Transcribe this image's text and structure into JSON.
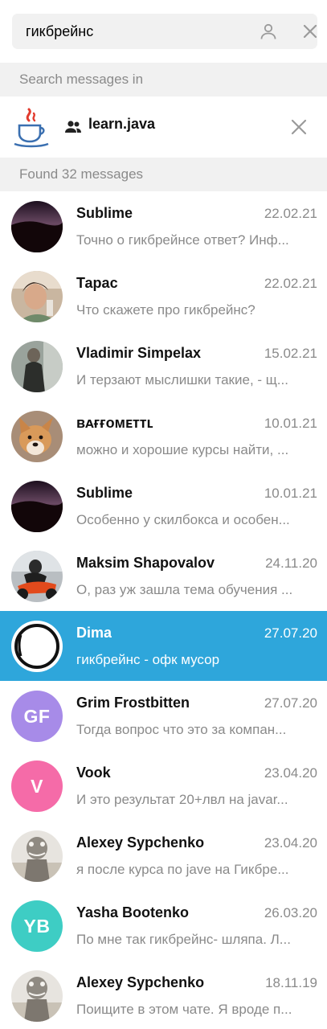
{
  "search": {
    "query": "гикбрейнс"
  },
  "scope": {
    "header": "Search messages in",
    "chat_name": "learn.java"
  },
  "results": {
    "header": "Found 32 messages",
    "items": [
      {
        "name": "Sublime",
        "date": "22.02.21",
        "text": "Точно о гикбрейнсе ответ? Инф...",
        "avatar": "photo-dark-sky"
      },
      {
        "name": "Тарас",
        "date": "22.02.21",
        "text": "Что скажете про гикбрейнс?",
        "avatar": "photo-person"
      },
      {
        "name": "Vladimir Simpelax",
        "date": "15.02.21",
        "text": "И терзают мыслишки такие, - щ...",
        "avatar": "photo-person-dark"
      },
      {
        "name": "ʙᴀғғᴏᴍᴇᴛᴛʟ",
        "date": "10.01.21",
        "text": "можно и хорошие курсы найти, ...",
        "avatar": "photo-dog"
      },
      {
        "name": "Sublime",
        "date": "10.01.21",
        "text": "Особенно у скилбокса и особен...",
        "avatar": "photo-dark-sky"
      },
      {
        "name": "Maksim Shapovalov",
        "date": "24.11.20",
        "text": "О, раз уж зашла тема обучения ...",
        "avatar": "photo-motorcycle"
      },
      {
        "name": "Dima",
        "date": "27.07.20",
        "text": "гикбрейнс - офк мусор",
        "avatar": "photo-ring",
        "selected": true
      },
      {
        "name": "Grim Frostbitten",
        "date": "27.07.20",
        "text": "Тогда вопрос что это за компан...",
        "initials": "GF",
        "color": "#a78be8"
      },
      {
        "name": "Vook",
        "date": "23.04.20",
        "text": "И это результат 20+лвл на javar...",
        "initials": "V",
        "color": "#f56ba8"
      },
      {
        "name": "Alexey Sypchenko",
        "date": "23.04.20",
        "text": "я после курса по jave на Гикбре...",
        "avatar": "photo-statue"
      },
      {
        "name": "Yasha Bootenko",
        "date": "26.03.20",
        "text": "По мне так гикбрейнс- шляпа. Л...",
        "initials": "YB",
        "color": "#3ecdc4"
      },
      {
        "name": "Alexey Sypchenko",
        "date": "18.11.19",
        "text": "Поищите в этом чате. Я вроде п...",
        "avatar": "photo-statue"
      }
    ]
  },
  "colors": {
    "accent": "#2ea6db",
    "muted_text": "#8a8a8a",
    "section_bg": "#f1f1f1"
  }
}
